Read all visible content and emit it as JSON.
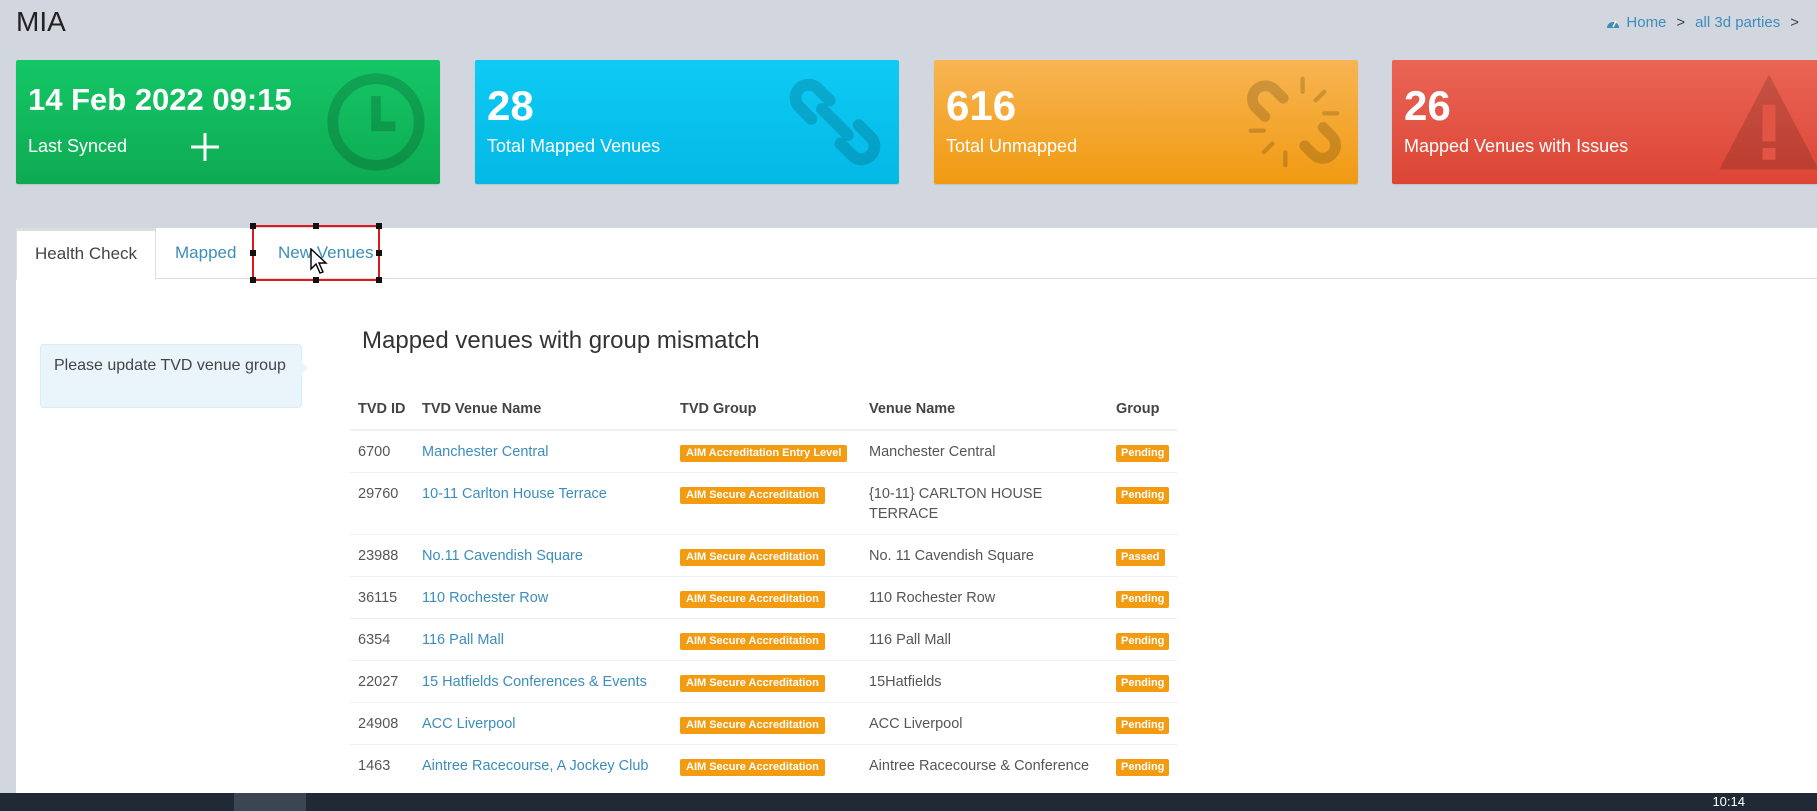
{
  "app": {
    "title": "MIA"
  },
  "breadcrumb": {
    "home": "Home",
    "sep1": ">",
    "current": "all 3d parties",
    "sep2": ">"
  },
  "stats": [
    {
      "value": "14 Feb 2022 09:15",
      "label": "Last Synced",
      "icon": "clock-icon",
      "color": "#0eaa52"
    },
    {
      "value": "28",
      "label": "Total Mapped Venues",
      "icon": "link-icon",
      "color": "#04b8e6"
    },
    {
      "value": "616",
      "label": "Total Unmapped",
      "icon": "unlink-icon",
      "color": "#f19a12"
    },
    {
      "value": "26",
      "label": "Mapped Venues with Issues",
      "icon": "warning-icon",
      "color": "#dc4535"
    }
  ],
  "tabs": [
    {
      "label": "Health Check",
      "active": true
    },
    {
      "label": "Mapped",
      "active": false
    },
    {
      "label": "New Venues",
      "active": false
    }
  ],
  "callout": {
    "text": "Please update TVD venue group"
  },
  "section": {
    "title": "Mapped venues with group mismatch"
  },
  "table": {
    "headers": {
      "id": "TVD ID",
      "name": "TVD Venue Name",
      "group": "TVD Group",
      "venue": "Venue Name",
      "status": "Group"
    },
    "rows": [
      {
        "id": "6700",
        "name": "Manchester Central",
        "group": "AIM Accreditation Entry Level",
        "venue": "Manchester Central",
        "status": "Pending"
      },
      {
        "id": "29760",
        "name": "10-11 Carlton House Terrace",
        "group": "AIM Secure Accreditation",
        "venue": "{10-11} CARLTON HOUSE TERRACE",
        "status": "Pending"
      },
      {
        "id": "23988",
        "name": "No.11 Cavendish Square",
        "group": "AIM Secure Accreditation",
        "venue": "No. 11 Cavendish Square",
        "status": "Passed"
      },
      {
        "id": "36115",
        "name": "110 Rochester Row",
        "group": "AIM Secure Accreditation",
        "venue": "110 Rochester Row",
        "status": "Pending"
      },
      {
        "id": "6354",
        "name": "116 Pall Mall",
        "group": "AIM Secure Accreditation",
        "venue": "116 Pall Mall",
        "status": "Pending"
      },
      {
        "id": "22027",
        "name": "15 Hatfields Conferences & Events",
        "group": "AIM Secure Accreditation",
        "venue": "15Hatfields",
        "status": "Pending"
      },
      {
        "id": "24908",
        "name": "ACC Liverpool",
        "group": "AIM Secure Accreditation",
        "venue": "ACC Liverpool",
        "status": "Pending"
      },
      {
        "id": "1463",
        "name": "Aintree Racecourse, A Jockey Club",
        "group": "AIM Secure Accreditation",
        "venue": "Aintree Racecourse & Conference",
        "status": "Pending"
      }
    ]
  },
  "taskbar": {
    "clock": "10:14"
  }
}
